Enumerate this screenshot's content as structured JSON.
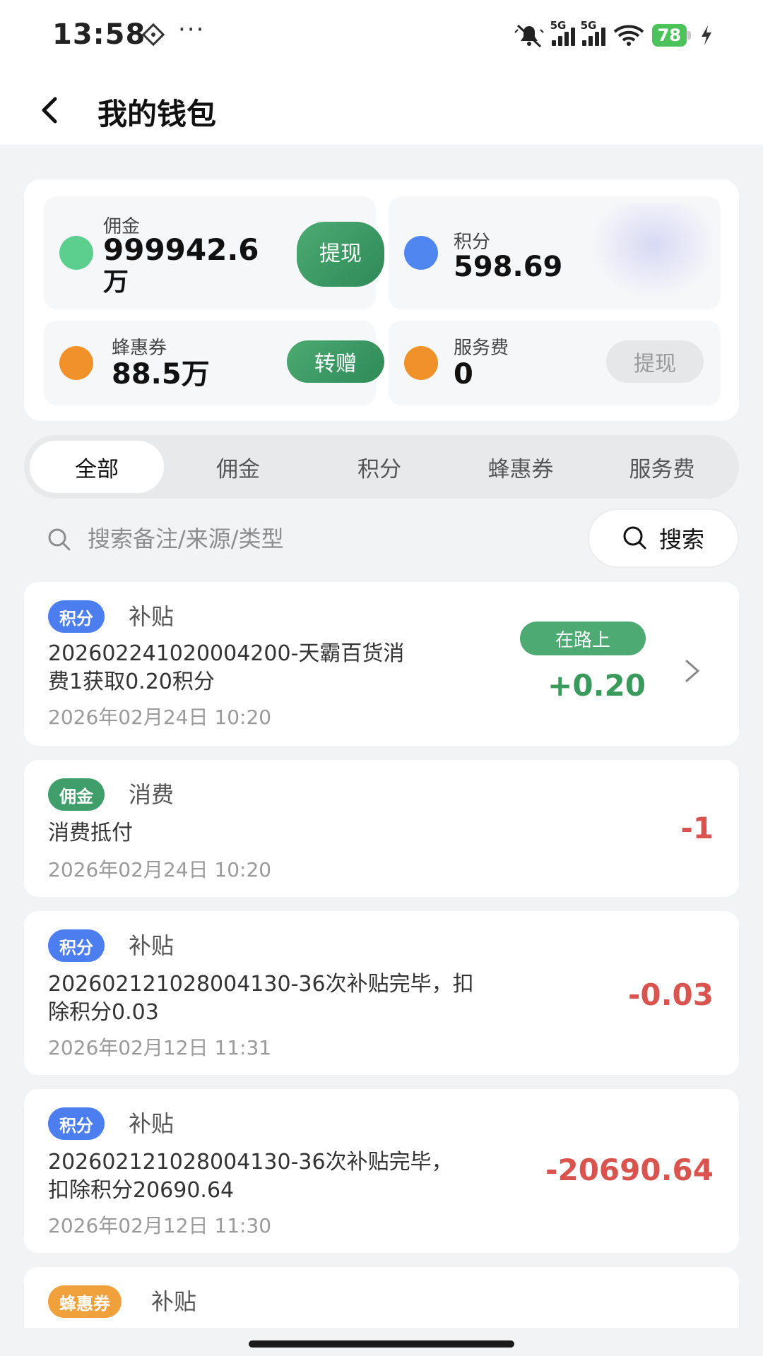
{
  "status_bar": {
    "time": "13:58",
    "more": "···",
    "battery": "78",
    "network_1": "5G",
    "network_2": "5G"
  },
  "header": {
    "title": "我的钱包"
  },
  "wallet": {
    "commission": {
      "label": "佣金",
      "value": "999942.6",
      "unit": "万",
      "button": "提现",
      "color": "#5ccf8f"
    },
    "points": {
      "label": "积分",
      "value": "598.69",
      "color": "#4f86ef"
    },
    "coupon": {
      "label": "蜂惠券",
      "value": "88.5万",
      "button": "转赠",
      "color": "#f0912a"
    },
    "service_fee": {
      "label": "服务费",
      "value": "0",
      "button": "提现",
      "color": "#f0912a"
    }
  },
  "tabs": [
    {
      "label": "全部",
      "active": true
    },
    {
      "label": "佣金",
      "active": false
    },
    {
      "label": "积分",
      "active": false
    },
    {
      "label": "蜂惠券",
      "active": false
    },
    {
      "label": "服务费",
      "active": false
    }
  ],
  "search": {
    "placeholder": "搜索备注/来源/类型",
    "value": "",
    "button": "搜索"
  },
  "records": [
    {
      "tag": "积分",
      "type": "补贴",
      "desc_line1": "20260224102000420​0-天霸百货消",
      "desc_line2": "费1获取0.20积分",
      "time": "2026年02月24日 10:20",
      "status": "在路上",
      "amount": "+0.20"
    },
    {
      "tag": "佣金",
      "type": "消费",
      "desc_line1": "消费抵付",
      "time": "2026年02月24日 10:20",
      "amount": "-1"
    },
    {
      "tag": "积分",
      "type": "补贴",
      "desc_line1": "202602121028004130-36次补贴完毕，扣",
      "desc_line2": "除积分0.03",
      "time": "2026年02月12日 11:31",
      "amount": "-0.03"
    },
    {
      "tag": "积分",
      "type": "补贴",
      "desc_line1": "202602121028004130-36次补贴完毕，",
      "desc_line2": "扣除积分20690.64",
      "time": "2026年02月12日 11:30",
      "amount": "-20690.64"
    },
    {
      "tag": "蜂惠券",
      "type": "补贴"
    }
  ]
}
